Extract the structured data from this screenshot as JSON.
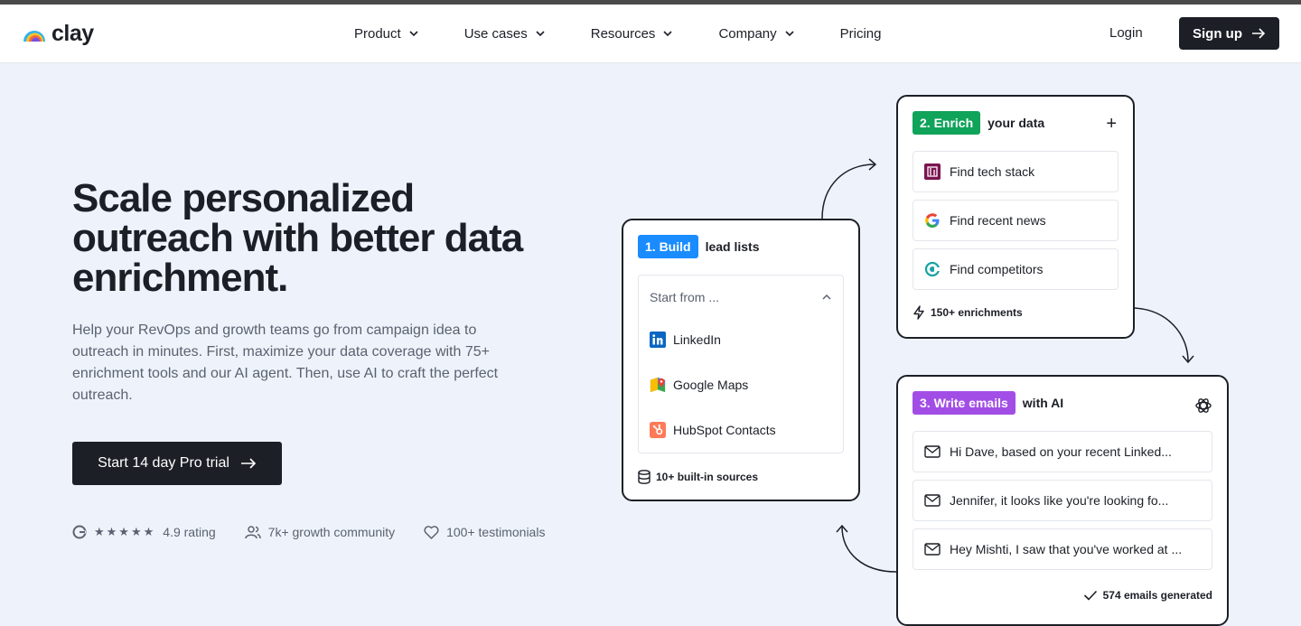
{
  "nav": {
    "logo_text": "clay",
    "links": [
      {
        "label": "Product"
      },
      {
        "label": "Use cases"
      },
      {
        "label": "Resources"
      },
      {
        "label": "Company"
      },
      {
        "label": "Pricing"
      }
    ],
    "login": "Login",
    "signup": "Sign up"
  },
  "hero": {
    "headline": "Scale personalized outreach with better data enrichment.",
    "subtext": "Help your RevOps and growth teams go from campaign idea to outreach in minutes. First, maximize your data coverage with 75+ enrichment tools and our AI agent. Then, use AI to craft the perfect outreach.",
    "cta": "Start 14 day Pro trial",
    "stats": {
      "rating": "4.9 rating",
      "community": "7k+ growth community",
      "testimonials": "100+ testimonials"
    }
  },
  "build": {
    "pill": "1. Build",
    "title": "lead lists",
    "dropdown_label": "Start from ...",
    "items": [
      {
        "label": "LinkedIn"
      },
      {
        "label": "Google Maps"
      },
      {
        "label": "HubSpot Contacts"
      }
    ],
    "footer": "10+ built-in sources"
  },
  "enrich": {
    "pill": "2. Enrich",
    "title": "your data",
    "items": [
      {
        "label": "Find tech stack"
      },
      {
        "label": "Find recent news"
      },
      {
        "label": "Find competitors"
      }
    ],
    "footer": "150+ enrichments"
  },
  "write": {
    "pill": "3. Write emails",
    "title": "with AI",
    "items": [
      {
        "label": "Hi Dave, based on your recent Linked..."
      },
      {
        "label": "Jennifer, it looks like you're looking fo..."
      },
      {
        "label": "Hey Mishti, I saw that you've worked at ..."
      }
    ],
    "footer": "574 emails generated"
  },
  "colors": {
    "build_pill": "#1a8cff",
    "enrich_pill": "#10a35a",
    "write_pill": "#a24ee6",
    "background": "#eef3fb",
    "ink": "#1c1f26"
  }
}
